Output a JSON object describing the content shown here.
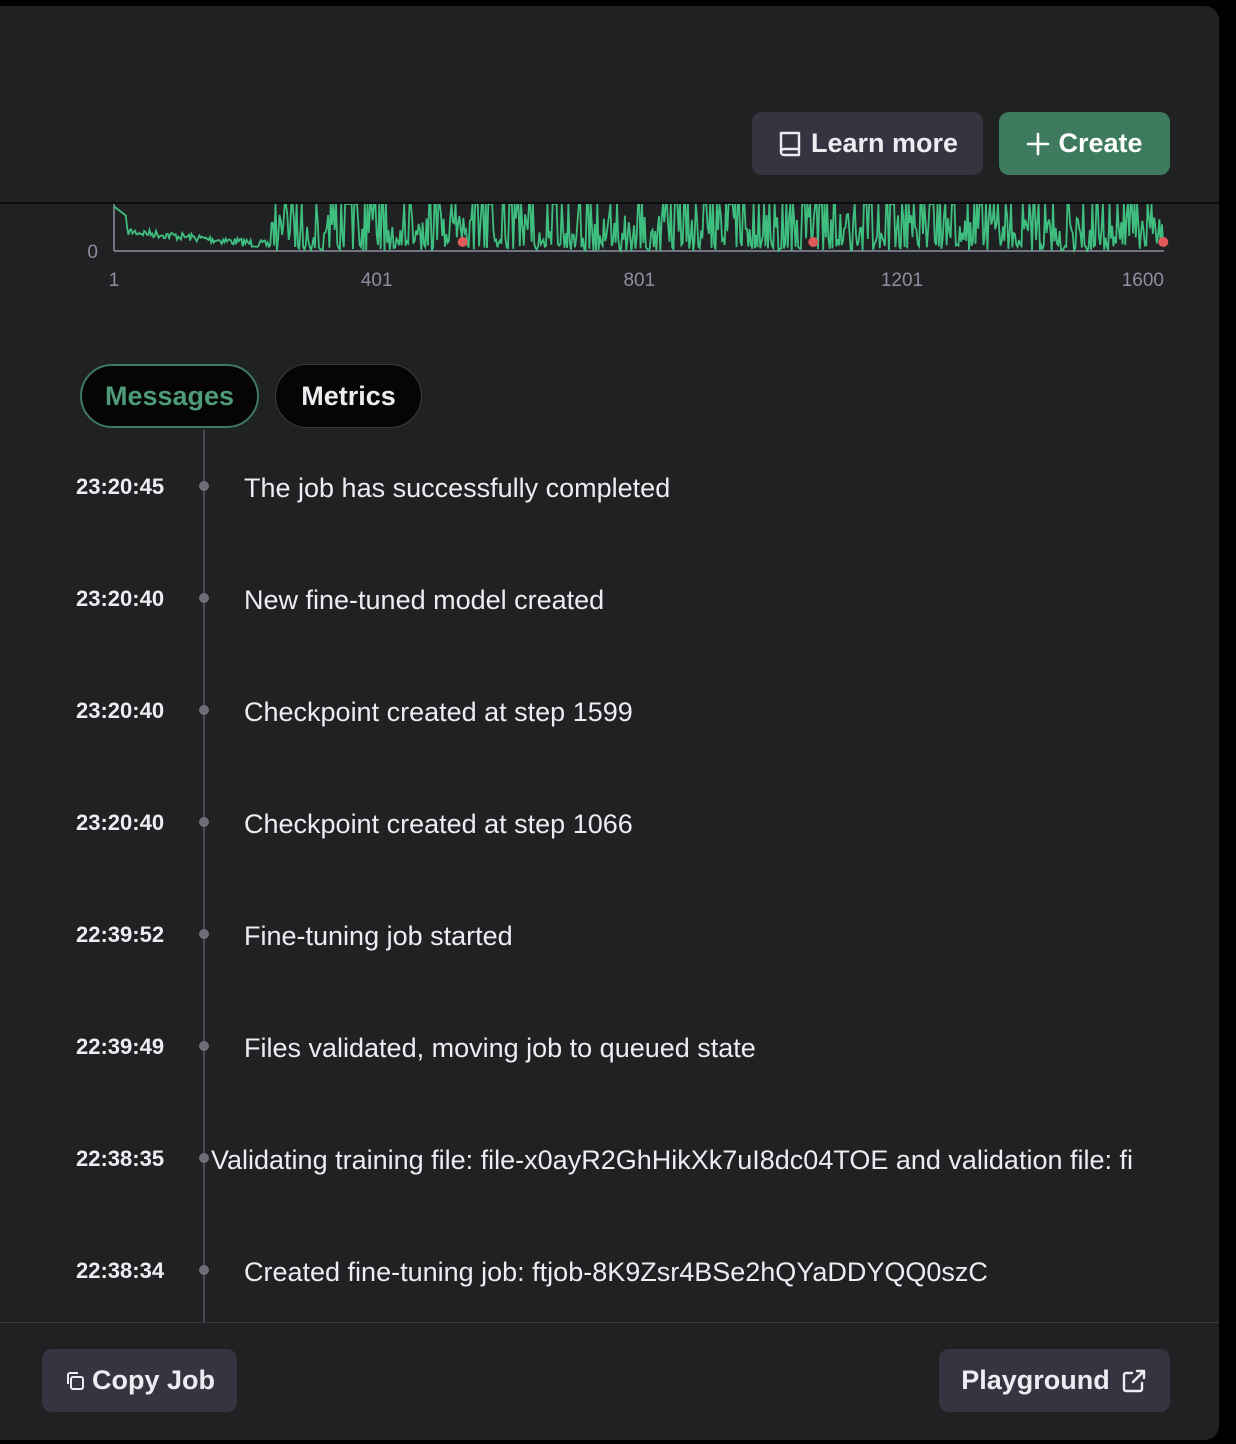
{
  "header": {
    "learn_more_label": "Learn more",
    "create_label": "Create",
    "accent_color": "#3d7a5e"
  },
  "chart_data": {
    "type": "line",
    "x_ticks": [
      "1",
      "401",
      "801",
      "1201",
      "1600"
    ],
    "y_ticks": [
      "0"
    ],
    "xlim": [
      1,
      1600
    ],
    "series_color": "#3fbf7f",
    "checkpoint_color": "#e05a5a",
    "checkpoints_x": [
      532,
      1066,
      1599
    ]
  },
  "tabs": [
    {
      "label": "Messages",
      "active": true
    },
    {
      "label": "Metrics",
      "active": false
    }
  ],
  "messages": [
    {
      "time": "23:20:45",
      "text": "The job has successfully completed"
    },
    {
      "time": "23:20:40",
      "text": "New fine-tuned model created"
    },
    {
      "time": "23:20:40",
      "text": "Checkpoint created at step 1599"
    },
    {
      "time": "23:20:40",
      "text": "Checkpoint created at step 1066"
    },
    {
      "time": "22:39:52",
      "text": "Fine-tuning job started"
    },
    {
      "time": "22:39:49",
      "text": "Files validated, moving job to queued state"
    },
    {
      "time": "22:38:35",
      "text": "Validating training file: file-x0ayR2GhHikXk7uI8dc04TOE and validation file: fi"
    },
    {
      "time": "22:38:34",
      "text": "Created fine-tuning job: ftjob-8K9Zsr4BSe2hQYaDDYQQ0szC"
    }
  ],
  "footer": {
    "copy_job_label": "Copy Job",
    "playground_label": "Playground"
  }
}
